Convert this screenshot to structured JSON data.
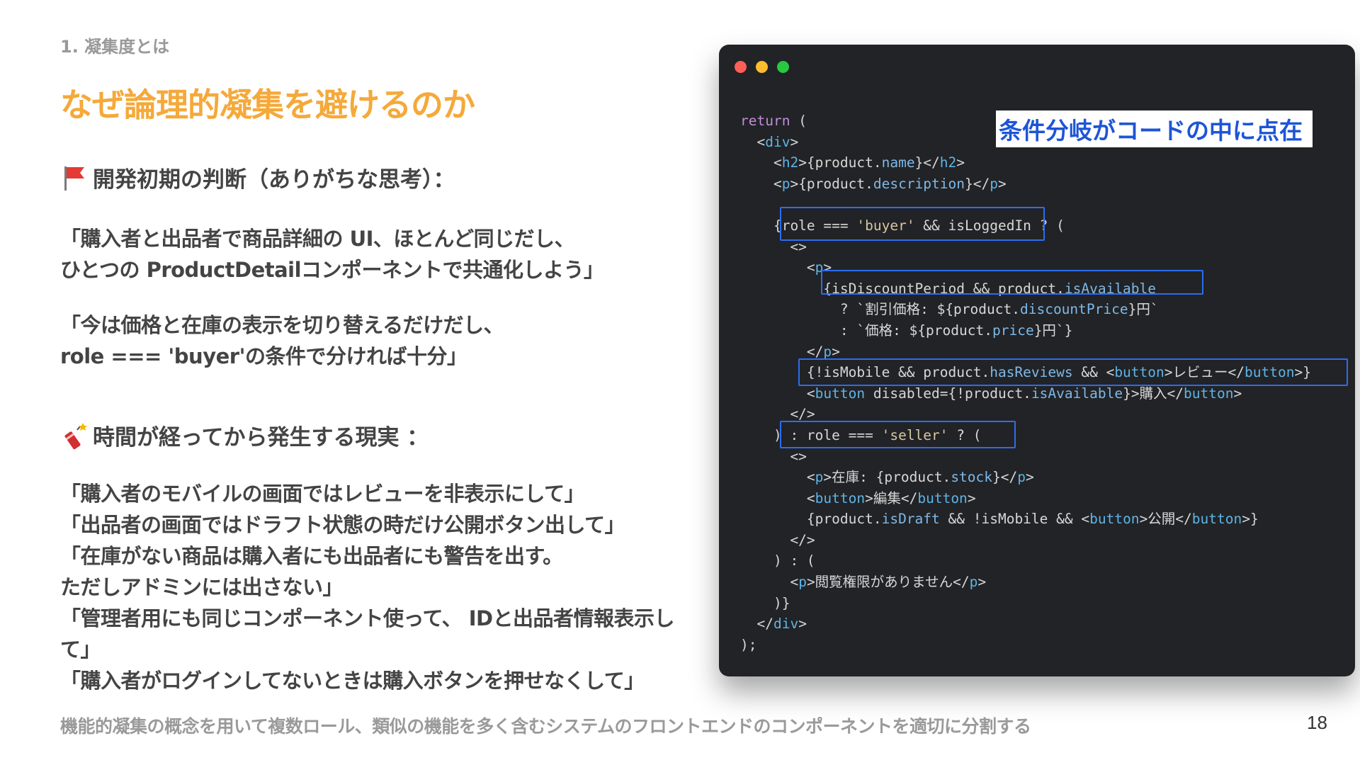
{
  "section_label": "1. 凝集度とは",
  "title": "なぜ論理的凝集を避けるのか",
  "initial": {
    "heading": "開発初期の判断（ありがちな思考）：",
    "quotes": [
      "「購入者と出品者で商品詳細の UI、ほとんど同じだし、",
      "ひとつの ProductDetailコンポーネントで共通化しよう」",
      "「今は価格と在庫の表示を切り替えるだけだし、",
      "role === 'buyer'の条件で分ければ十分」"
    ]
  },
  "later": {
    "heading": "時間が経ってから発生する現実 ：",
    "quotes": [
      "「購入者のモバイルの画面ではレビューを非表示にして」",
      "「出品者の画面ではドラフト状態の時だけ公開ボタン出して」",
      "「在庫がない商品は購入者にも出品者にも警告を出す。",
      "ただしアドミンには出さない」",
      "「管理者用にも同じコンポーネント使って、 IDと出品者情報表示し",
      "て」",
      "「購入者がログインしてないときは購入ボタンを押せなくして」"
    ]
  },
  "footer": "機能的凝集の概念を用いて複数ロール、類似の機能を多く含むシステムのフロントエンドのコンポーネントを適切に分割する",
  "page_number": "18",
  "code_window": {
    "callout": "条件分岐がコードの中に点在",
    "lines": [
      "return (",
      "  <div>",
      "    <h2>{product.name}</h2>",
      "    <p>{product.description}</p>",
      "",
      "    {role === 'buyer' && isLoggedIn ? (",
      "      <>",
      "        <p>",
      "          {isDiscountPeriod && product.isAvailable",
      "            ? `割引価格: ${product.discountPrice}円`",
      "            : `価格: ${product.price}円`}",
      "        </p>",
      "        {!isMobile && product.hasReviews && <button>レビュー</button>}",
      "        <button disabled={!product.isAvailable}>購入</button>",
      "      </>",
      "    ) : role === 'seller' ? (",
      "      <>",
      "        <p>在庫: {product.stock}</p>",
      "        <button>編集</button>",
      "        {product.isDraft && !isMobile && <button>公開</button>}",
      "      </>",
      "    ) : (",
      "      <p>閲覧権限がありません</p>",
      "    )}",
      "  </div>",
      ");"
    ]
  },
  "icons": {
    "initial": "red-flag-icon",
    "later": "firecracker-icon"
  },
  "colors": {
    "title": "#f5a93a",
    "text": "#444444",
    "muted": "#999999",
    "code_bg": "#212326",
    "highlight": "#2d6cf0",
    "callout_text": "#1e55d6",
    "dot_red": "#fe5f57",
    "dot_yellow": "#febc2e",
    "dot_green": "#28c840"
  }
}
